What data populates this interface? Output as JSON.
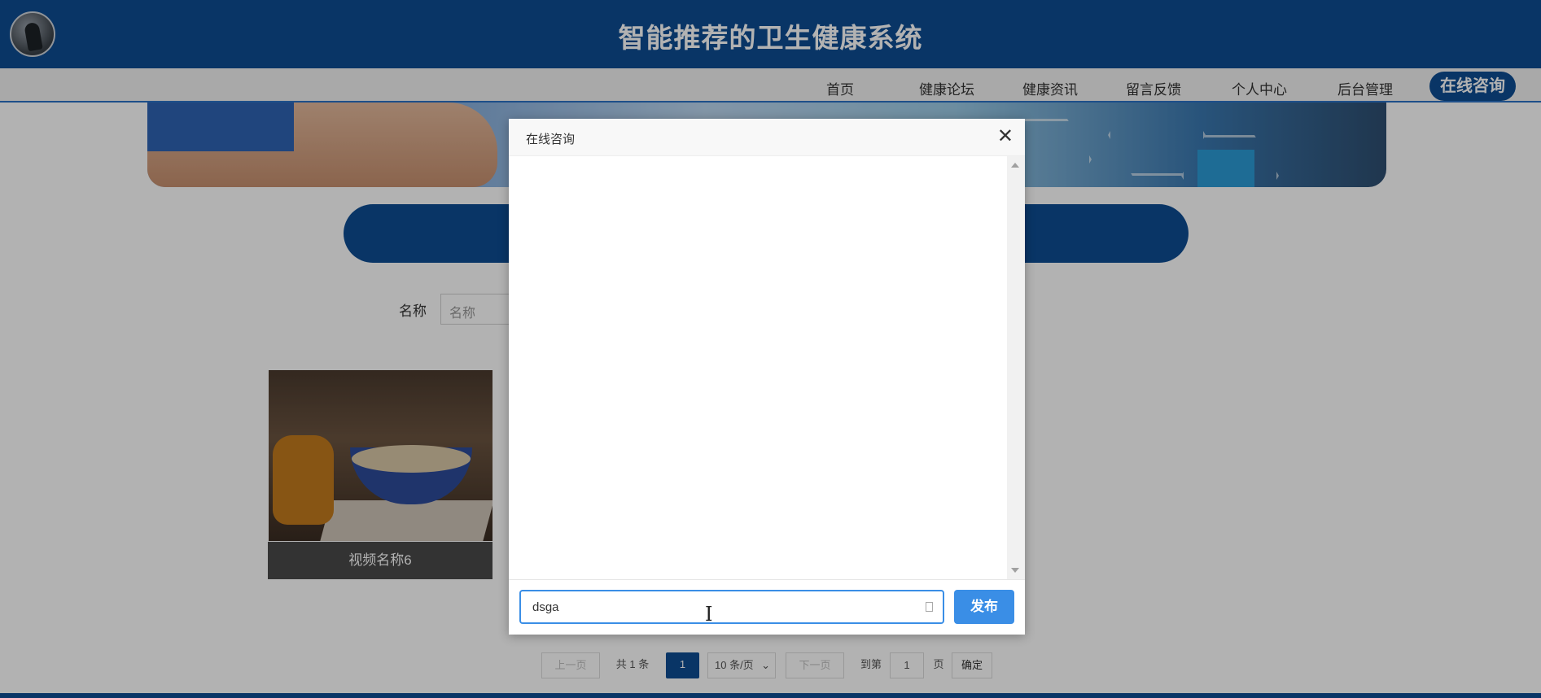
{
  "header": {
    "title": "智能推荐的卫生健康系统"
  },
  "nav": {
    "items": [
      "首页",
      "健康论坛",
      "健康资讯",
      "留言反馈",
      "个人中心",
      "后台管理"
    ],
    "consult_label": "在线咨询"
  },
  "search": {
    "label": "名称",
    "placeholder": "名称"
  },
  "card": {
    "caption": "视频名称6"
  },
  "pagination": {
    "prev_label": "上一页",
    "total_label": "共 1 条",
    "current_page": "1",
    "page_size_label": "10 条/页",
    "next_label": "下一页",
    "goto_label": "到第",
    "goto_value": "1",
    "page_unit_label": "页",
    "confirm_label": "确定"
  },
  "dialog": {
    "title": "在线咨询",
    "close_symbol": "✕",
    "input_value": "dsga",
    "send_label": "发布"
  },
  "colors": {
    "primary": "#0d4c92",
    "send_button": "#3a8ee6"
  },
  "icons": {
    "logo": "avatar-logo",
    "close": "close-icon",
    "cursor": "text-cursor-icon",
    "emoji": "emoji-icon"
  }
}
